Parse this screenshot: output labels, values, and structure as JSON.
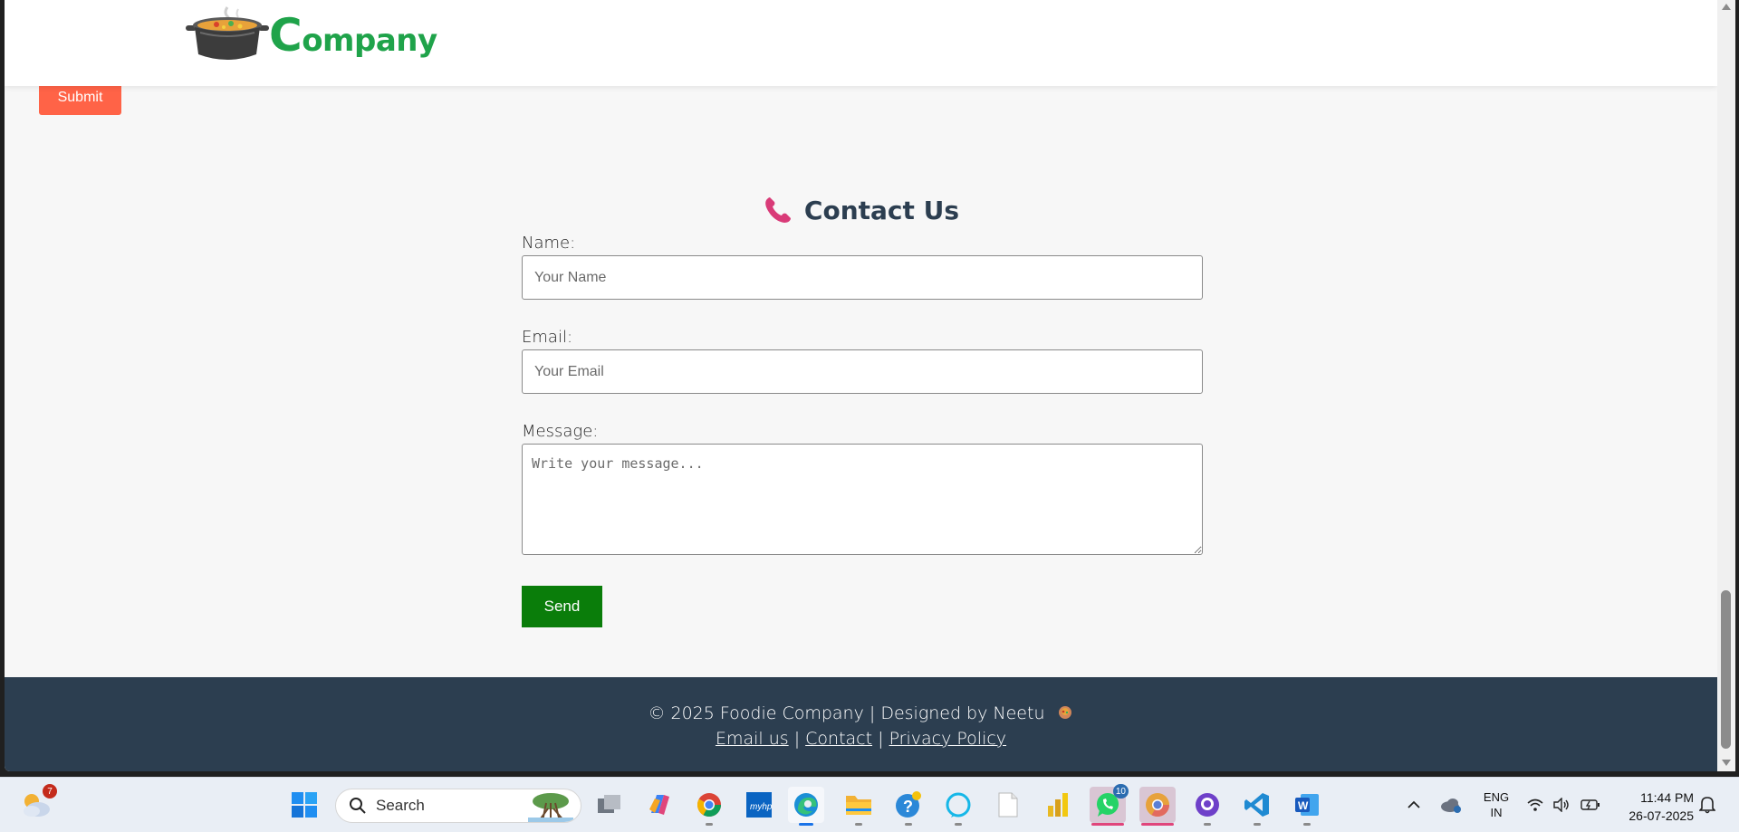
{
  "header": {
    "logo_text_first": "C",
    "logo_text_rest": "ompany",
    "logo_icon": "cooking-pot-icon"
  },
  "submit_label": "Submit",
  "contact": {
    "title": "Contact Us",
    "title_icon": "telephone-receiver-icon",
    "name_label": "Name:",
    "name_placeholder": "Your Name",
    "email_label": "Email:",
    "email_placeholder": "Your Email",
    "message_label": "Message:",
    "message_placeholder": "Write your message...",
    "send_label": "Send"
  },
  "footer": {
    "copyright": "© 2025 Foodie Company | Designed by Neetu",
    "emoji_icon": "cooking-emoji-icon",
    "links": [
      "Email us",
      "Contact",
      "Privacy Policy"
    ],
    "separator": "|"
  },
  "colors": {
    "accent_green": "#1fa34a",
    "submit": "#ff6347",
    "send": "#0a7d0a",
    "footer_bg": "#2c3e50",
    "title": "#2c3e50"
  },
  "taskbar": {
    "weather_badge": "7",
    "search_placeholder": "Search",
    "whatsapp_badge": "10",
    "language_line1": "ENG",
    "language_line2": "IN",
    "time": "11:44 PM",
    "date": "26-07-2025",
    "apps": [
      "windows-start-icon",
      "task-view-icon",
      "copilot-icon",
      "chrome-icon",
      "myhp-icon",
      "edge-icon",
      "file-explorer-icon",
      "get-help-icon",
      "alexa-icon",
      "notepad-icon",
      "power-bi-icon",
      "whatsapp-icon",
      "chrome-profile-icon",
      "github-icon",
      "vscode-icon",
      "word-icon"
    ]
  }
}
